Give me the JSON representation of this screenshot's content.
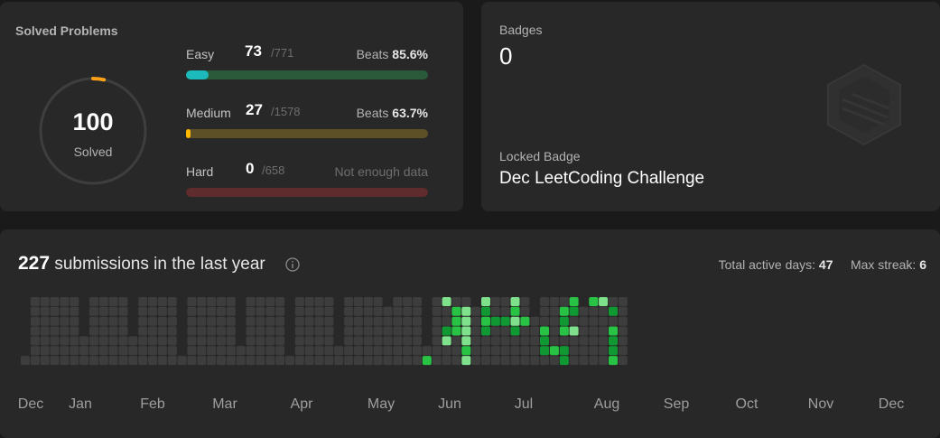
{
  "solved": {
    "title": "Solved Problems",
    "total": "100",
    "total_label": "Solved",
    "difficulties": [
      {
        "name": "Easy",
        "solved": "73",
        "total": "/771",
        "beats_label": "Beats",
        "beats_value": "85.6%",
        "progress": 0.0947,
        "bar_color": "#1cbaba",
        "track_color": "#2b5a3b"
      },
      {
        "name": "Medium",
        "solved": "27",
        "total": "/1578",
        "beats_label": "Beats",
        "beats_value": "63.7%",
        "progress": 0.0171,
        "bar_color": "#ffb700",
        "track_color": "#5e5026"
      },
      {
        "name": "Hard",
        "solved": "0",
        "total": "/658",
        "beats_label": "Not enough data",
        "beats_value": "",
        "progress": 0,
        "bar_color": "#ef4743",
        "track_color": "#5e2c2c"
      }
    ],
    "ring_progress": 0.0334,
    "ring_color": "#ffa116"
  },
  "badges": {
    "label": "Badges",
    "count": "0",
    "locked_label": "Locked Badge",
    "locked_name": "Dec LeetCoding Challenge",
    "icon": "hexagon-badge-icon"
  },
  "calendar": {
    "count": "227",
    "text": "submissions in the last year",
    "active_label": "Total active days:",
    "active_value": "47",
    "streak_label": "Max streak:",
    "streak_value": "6",
    "info_icon": "info-icon",
    "months": [
      "Dec",
      "Jan",
      "Feb",
      "Mar",
      "Apr",
      "May",
      "Jun",
      "Jul",
      "Aug",
      "Sep",
      "Oct",
      "Nov",
      "Dec"
    ],
    "colors": {
      "empty": "#3d3d3d",
      "l1": "#016620",
      "l2": "#109932",
      "l3": "#28c244",
      "l4": "#7fe18b"
    },
    "weeks": [
      [
        null,
        null,
        null,
        null,
        null,
        null,
        0
      ],
      [
        0,
        0,
        0,
        0,
        0,
        0,
        0
      ],
      [
        0,
        0,
        0,
        0,
        0,
        0,
        0
      ],
      [
        0,
        0,
        0,
        0,
        0,
        0,
        0
      ],
      [
        0,
        0,
        0,
        0,
        0,
        0,
        0
      ],
      [
        0,
        0,
        0,
        0,
        0,
        0,
        0
      ],
      [
        null,
        null,
        null,
        null,
        0,
        0,
        0
      ],
      [
        0,
        0,
        0,
        0,
        0,
        0,
        0
      ],
      [
        0,
        0,
        0,
        0,
        0,
        0,
        0
      ],
      [
        0,
        0,
        0,
        0,
        0,
        0,
        0
      ],
      [
        0,
        0,
        0,
        0,
        0,
        0,
        0
      ],
      [
        null,
        null,
        null,
        null,
        0,
        0,
        0
      ],
      [
        0,
        0,
        0,
        0,
        0,
        0,
        0
      ],
      [
        0,
        0,
        0,
        0,
        0,
        0,
        0
      ],
      [
        0,
        0,
        0,
        0,
        0,
        0,
        0
      ],
      [
        0,
        0,
        0,
        0,
        0,
        0,
        0
      ],
      [
        null,
        null,
        null,
        null,
        null,
        null,
        0
      ],
      [
        0,
        0,
        0,
        0,
        0,
        0,
        0
      ],
      [
        0,
        0,
        0,
        0,
        0,
        0,
        0
      ],
      [
        0,
        0,
        0,
        0,
        0,
        0,
        0
      ],
      [
        0,
        0,
        0,
        0,
        0,
        0,
        0
      ],
      [
        0,
        0,
        0,
        0,
        0,
        0,
        0
      ],
      [
        null,
        null,
        null,
        null,
        null,
        0,
        0
      ],
      [
        0,
        0,
        0,
        0,
        0,
        0,
        0
      ],
      [
        0,
        0,
        0,
        0,
        0,
        0,
        0
      ],
      [
        0,
        0,
        0,
        0,
        0,
        0,
        0
      ],
      [
        0,
        0,
        0,
        0,
        0,
        0,
        0
      ],
      [
        null,
        null,
        null,
        null,
        null,
        null,
        0
      ],
      [
        0,
        0,
        0,
        0,
        0,
        0,
        0
      ],
      [
        0,
        0,
        0,
        0,
        0,
        0,
        0
      ],
      [
        0,
        0,
        0,
        0,
        0,
        0,
        0
      ],
      [
        0,
        0,
        0,
        0,
        0,
        0,
        0
      ],
      [
        null,
        null,
        null,
        null,
        null,
        0,
        0
      ],
      [
        0,
        0,
        0,
        0,
        0,
        0,
        0
      ],
      [
        0,
        0,
        0,
        0,
        0,
        0,
        0
      ],
      [
        0,
        0,
        0,
        0,
        0,
        0,
        0
      ],
      [
        0,
        0,
        0,
        0,
        0,
        0,
        0
      ],
      [
        null,
        0,
        0,
        0,
        0,
        0,
        0
      ],
      [
        0,
        0,
        0,
        0,
        0,
        0,
        0
      ],
      [
        0,
        0,
        0,
        0,
        0,
        0,
        0
      ],
      [
        0,
        0,
        0,
        0,
        0,
        0,
        0
      ],
      [
        null,
        null,
        null,
        null,
        null,
        0,
        3
      ],
      [
        0,
        0,
        0,
        0,
        0,
        0,
        0
      ],
      [
        4,
        0,
        0,
        2,
        4,
        0,
        0
      ],
      [
        0,
        3,
        3,
        3,
        0,
        0,
        0
      ],
      [
        0,
        4,
        4,
        4,
        4,
        3,
        4
      ],
      [
        null,
        0,
        0,
        0,
        0,
        0,
        0
      ],
      [
        4,
        2,
        3,
        2,
        0,
        0,
        0
      ],
      [
        0,
        0,
        2,
        0,
        0,
        0,
        0
      ],
      [
        0,
        0,
        2,
        0,
        0,
        0,
        0
      ],
      [
        4,
        3,
        4,
        2,
        0,
        0,
        0
      ],
      [
        0,
        0,
        3,
        0,
        0,
        0,
        0
      ],
      [
        null,
        null,
        0,
        0,
        0,
        0,
        0
      ],
      [
        0,
        0,
        0,
        3,
        2,
        2,
        0
      ],
      [
        0,
        0,
        0,
        0,
        0,
        3,
        0
      ],
      [
        0,
        3,
        2,
        3,
        0,
        2,
        2
      ],
      [
        3,
        2,
        0,
        4,
        0,
        0,
        0
      ],
      [
        null,
        0,
        0,
        0,
        0,
        0,
        0
      ],
      [
        3,
        0,
        0,
        0,
        0,
        0,
        0
      ],
      [
        4,
        0,
        0,
        0,
        0,
        0,
        0
      ],
      [
        0,
        2,
        0,
        3,
        2,
        2,
        3
      ],
      [
        0,
        0,
        0,
        0,
        0,
        0,
        0
      ]
    ]
  }
}
